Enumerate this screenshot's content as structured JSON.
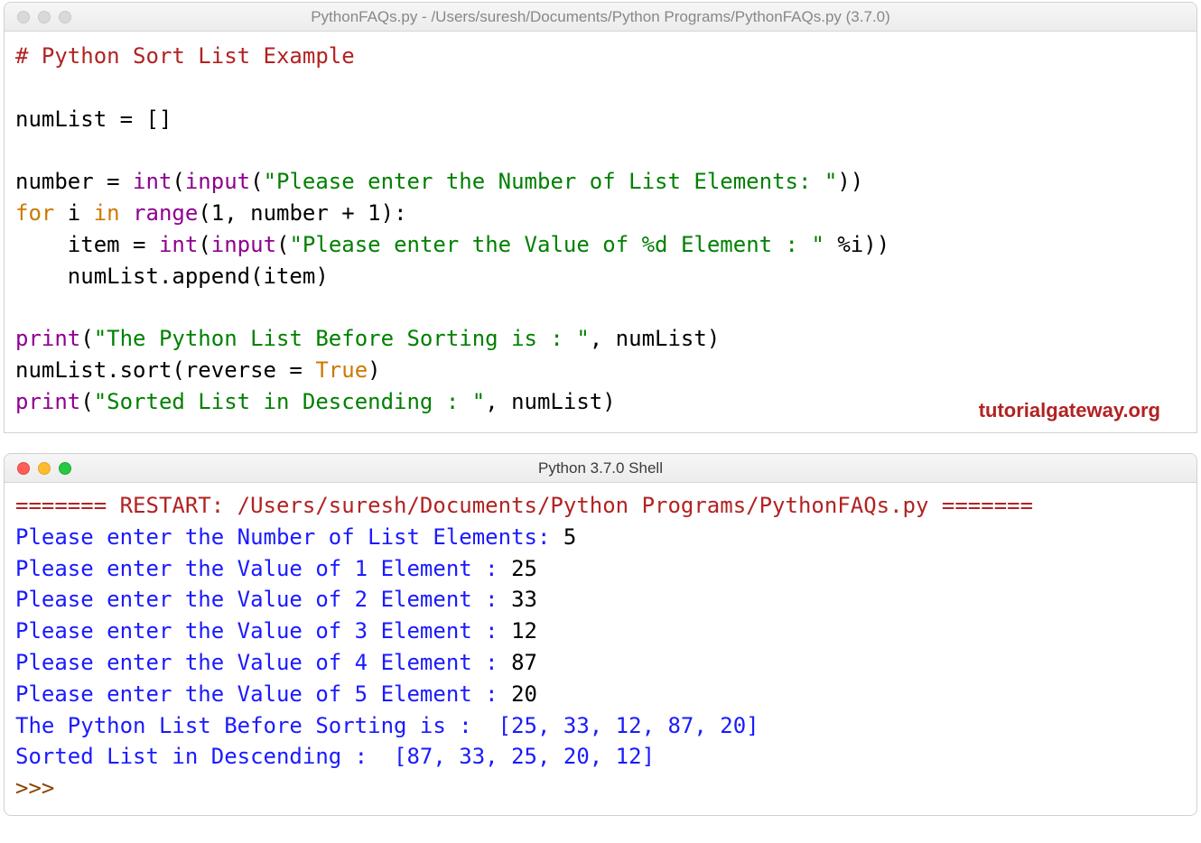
{
  "editor": {
    "title": "PythonFAQs.py - /Users/suresh/Documents/Python Programs/PythonFAQs.py (3.7.0)",
    "code": {
      "l1_comment": "# Python Sort List Example",
      "l3_a": "numList = []",
      "l5_a": "number = ",
      "l5_b": "int",
      "l5_c": "(",
      "l5_d": "input",
      "l5_e": "(",
      "l5_f": "\"Please enter the Number of List Elements: \"",
      "l5_g": "))",
      "l6_a": "for",
      "l6_b": " i ",
      "l6_c": "in",
      "l6_d": " ",
      "l6_e": "range",
      "l6_f": "(1, number + 1):",
      "l7_a": "    item = ",
      "l7_b": "int",
      "l7_c": "(",
      "l7_d": "input",
      "l7_e": "(",
      "l7_f": "\"Please enter the Value of %d Element : \"",
      "l7_g": " %i))",
      "l8_a": "    numList.append(item)",
      "l10_a": "print",
      "l10_b": "(",
      "l10_c": "\"The Python List Before Sorting is : \"",
      "l10_d": ", numList)",
      "l11_a": "numList.sort(reverse = ",
      "l11_b": "True",
      "l11_c": ")",
      "l12_a": "print",
      "l12_b": "(",
      "l12_c": "\"Sorted List in Descending : \"",
      "l12_d": ", numList)"
    },
    "watermark": "tutorialgateway.org"
  },
  "shell": {
    "title": "Python 3.7.0 Shell",
    "restart": "======= RESTART: /Users/suresh/Documents/Python Programs/PythonFAQs.py =======",
    "prompts": [
      {
        "p": "Please enter the Number of List Elements: ",
        "v": "5"
      },
      {
        "p": "Please enter the Value of 1 Element : ",
        "v": "25"
      },
      {
        "p": "Please enter the Value of 2 Element : ",
        "v": "33"
      },
      {
        "p": "Please enter the Value of 3 Element : ",
        "v": "12"
      },
      {
        "p": "Please enter the Value of 4 Element : ",
        "v": "87"
      },
      {
        "p": "Please enter the Value of 5 Element : ",
        "v": "20"
      }
    ],
    "out1": "The Python List Before Sorting is :  [25, 33, 12, 87, 20]",
    "out2": "Sorted List in Descending :  [87, 33, 25, 20, 12]",
    "repl": ">>> "
  }
}
